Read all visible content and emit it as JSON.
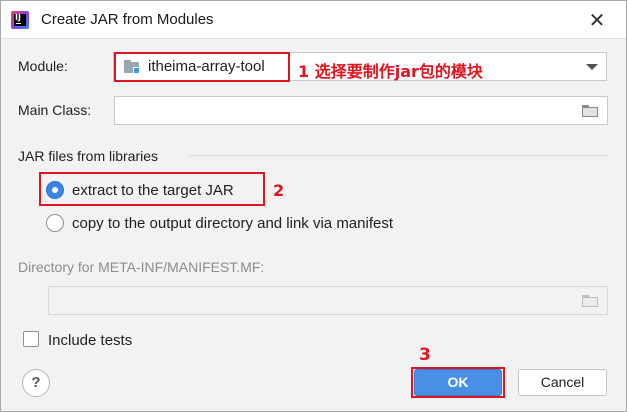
{
  "window": {
    "title": "Create JAR from Modules",
    "close_glyph": "✕"
  },
  "module": {
    "label": "Module:",
    "value": "itheima-array-tool"
  },
  "main_class": {
    "label": "Main Class:",
    "value": ""
  },
  "libraries": {
    "section_label": "JAR files from libraries",
    "option_extract": "extract to the target JAR",
    "option_copy": "copy to the output directory and link via manifest",
    "selected": "extract to the target JAR"
  },
  "manifest": {
    "label": "Directory for META-INF/MANIFEST.MF:",
    "value": ""
  },
  "include_tests": {
    "label": "Include tests",
    "checked": false
  },
  "buttons": {
    "help": "?",
    "ok": "OK",
    "cancel": "Cancel"
  },
  "annotations": {
    "step1": "1 选择要制作jar包的模块",
    "step2": "2",
    "step3": "3"
  },
  "icons": [
    "intellij-app-icon",
    "close-icon",
    "module-folder-icon",
    "dropdown-arrow-icon",
    "browse-folder-icon",
    "help-icon"
  ],
  "colors": {
    "accent": "#3b86e2",
    "annotation_red": "#e0141f",
    "ok_button": "#4a8fe6"
  }
}
